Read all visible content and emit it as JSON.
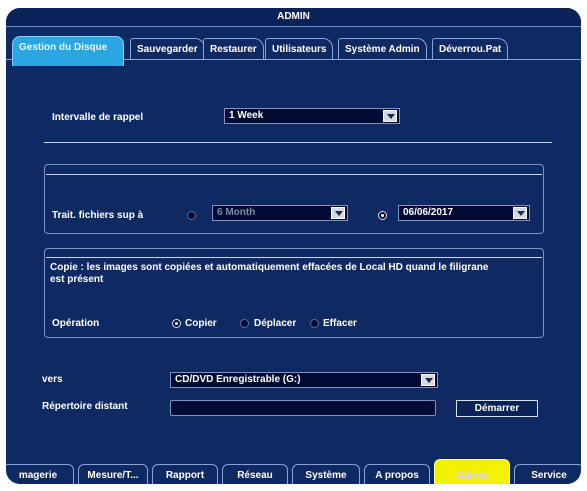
{
  "title": "ADMIN",
  "tabs": [
    "Gestion du Disque",
    "Sauvegarder",
    "Restaurer",
    "Utilisateurs",
    "Système Admin",
    "Déverrou.Pat"
  ],
  "active_tab": "Gestion du Disque",
  "interval": {
    "label": "Intervalle de rappel",
    "value": "1 Week"
  },
  "trait": {
    "label": "Trait. fichiers sup à",
    "period_value": "6 Month",
    "date_value": "06/06/2017",
    "selected": "date"
  },
  "copy": {
    "description": "Copie : les images sont copiées et automatiquement effacées de Local HD quand le filigrane est présent",
    "operation_label": "Opération",
    "options": [
      "Copier",
      "Déplacer",
      "Effacer"
    ],
    "selected": "Copier"
  },
  "vers": {
    "label": "vers",
    "value": "CD/DVD Enregistrable (G:)"
  },
  "remote": {
    "label": "Répertoire distant",
    "value": "",
    "start_label": "Démarrer"
  },
  "bottom_tabs": [
    "magerie",
    "Mesure/T...",
    "Rapport",
    "Réseau",
    "Système",
    "A propos",
    "Admin",
    "Service"
  ],
  "active_bottom_tab": "Admin",
  "colors": {
    "background": "#0f2a63",
    "active_tab": "#2aa6e2",
    "active_bottom_tab": "#f2f200"
  }
}
